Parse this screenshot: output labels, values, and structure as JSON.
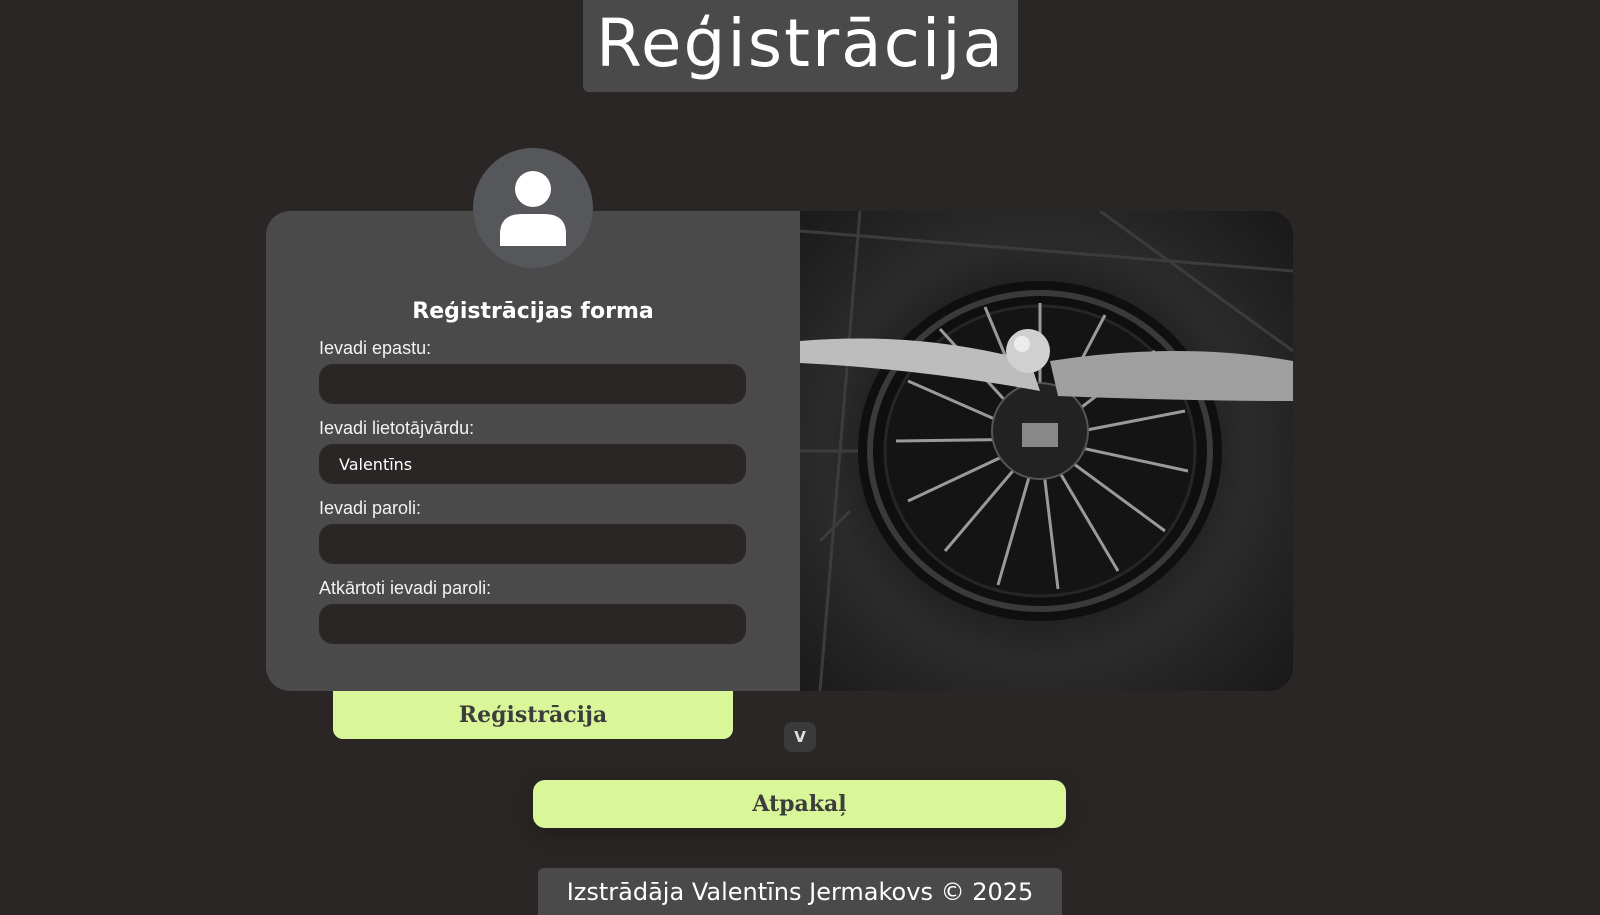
{
  "page": {
    "title": "Reģistrācija"
  },
  "form": {
    "heading": "Reģistrācijas forma",
    "fields": [
      {
        "label": "Ievadi epastu:",
        "value": ""
      },
      {
        "label": "Ievadi lietotājvārdu:",
        "value": "Valentīns"
      },
      {
        "label": "Ievadi paroli:",
        "value": ""
      },
      {
        "label": "Atkārtoti ievadi paroli:",
        "value": ""
      }
    ],
    "submit_label": "Reģistrācija"
  },
  "icons": {
    "avatar": "user-icon",
    "scroll": "chevron-down-icon"
  },
  "scroll_label": "V",
  "back_label": "Atpakaļ",
  "footer": {
    "text": "Izstrādāja Valentīns Jermakovs © 2025"
  },
  "colors": {
    "background": "#2a2625",
    "panel": "#4a4a4b",
    "accent": "#d9f799",
    "input": "#2a2625"
  }
}
